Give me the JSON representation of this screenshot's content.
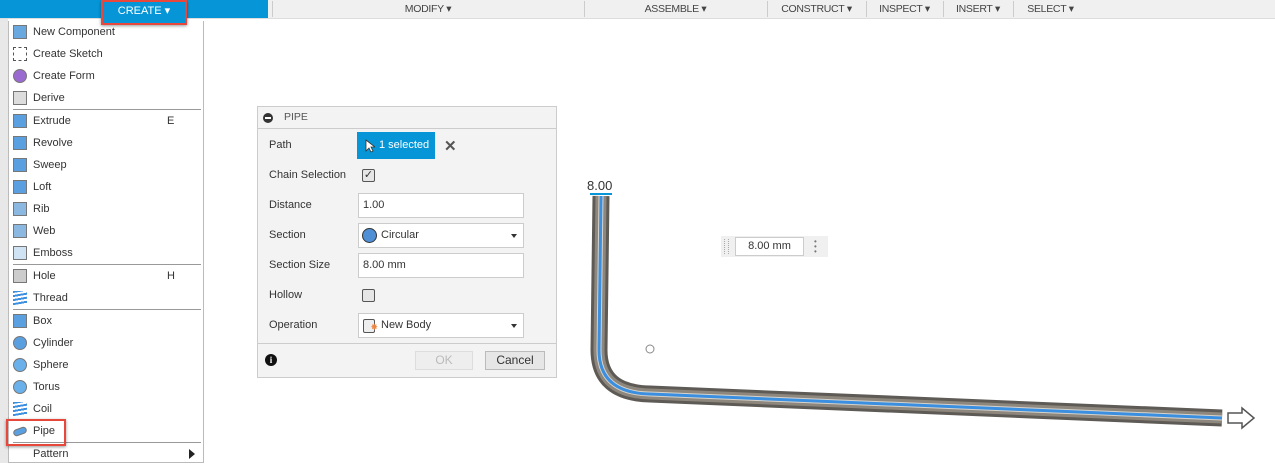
{
  "toolbar": {
    "create": "CREATE ▾",
    "modify": "MODIFY ▾",
    "assemble": "ASSEMBLE ▾",
    "construct": "CONSTRUCT ▾",
    "inspect": "INSPECT ▾",
    "insert": "INSERT ▾",
    "select": "SELECT ▾"
  },
  "menu": {
    "items": [
      {
        "label": "New Component",
        "icon": "new-component-icon",
        "shortcut": ""
      },
      {
        "label": "Create Sketch",
        "icon": "create-sketch-icon",
        "shortcut": ""
      },
      {
        "label": "Create Form",
        "icon": "create-form-icon",
        "shortcut": ""
      },
      {
        "label": "Derive",
        "icon": "derive-icon",
        "shortcut": ""
      },
      {
        "label": "Extrude",
        "icon": "extrude-icon",
        "shortcut": "E"
      },
      {
        "label": "Revolve",
        "icon": "revolve-icon",
        "shortcut": ""
      },
      {
        "label": "Sweep",
        "icon": "sweep-icon",
        "shortcut": ""
      },
      {
        "label": "Loft",
        "icon": "loft-icon",
        "shortcut": ""
      },
      {
        "label": "Rib",
        "icon": "rib-icon",
        "shortcut": ""
      },
      {
        "label": "Web",
        "icon": "web-icon",
        "shortcut": ""
      },
      {
        "label": "Emboss",
        "icon": "emboss-icon",
        "shortcut": ""
      },
      {
        "label": "Hole",
        "icon": "hole-icon",
        "shortcut": "H"
      },
      {
        "label": "Thread",
        "icon": "thread-icon",
        "shortcut": ""
      },
      {
        "label": "Box",
        "icon": "box-icon",
        "shortcut": ""
      },
      {
        "label": "Cylinder",
        "icon": "cylinder-icon",
        "shortcut": ""
      },
      {
        "label": "Sphere",
        "icon": "sphere-icon",
        "shortcut": ""
      },
      {
        "label": "Torus",
        "icon": "torus-icon",
        "shortcut": ""
      },
      {
        "label": "Coil",
        "icon": "coil-icon",
        "shortcut": ""
      },
      {
        "label": "Pipe",
        "icon": "pipe-icon",
        "shortcut": ""
      },
      {
        "label": "Pattern",
        "icon": "",
        "shortcut": ""
      }
    ]
  },
  "dialog": {
    "title": "PIPE",
    "path_label": "Path",
    "path_value": "1 selected",
    "chain_label": "Chain Selection",
    "chain_checked": "✓",
    "distance_label": "Distance",
    "distance_value": "1.00",
    "section_label": "Section",
    "section_value": "Circular",
    "size_label": "Section Size",
    "size_value": "8.00 mm",
    "hollow_label": "Hollow",
    "operation_label": "Operation",
    "operation_value": "New Body",
    "ok": "OK",
    "cancel": "Cancel"
  },
  "canvas": {
    "dimension": "8.00",
    "value_input": "8.00 mm"
  },
  "colors": {
    "accent": "#0696d7",
    "highlight": "#e8483b",
    "pipe": "#6f6a63",
    "path": "#3b8fe0"
  }
}
